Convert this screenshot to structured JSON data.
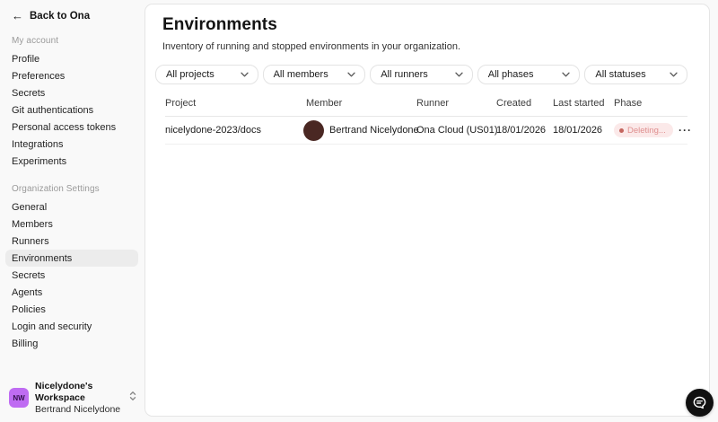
{
  "sidebar": {
    "back_label": "Back to Ona",
    "sections": [
      {
        "label": "My account",
        "items": [
          "Profile",
          "Preferences",
          "Secrets",
          "Git authentications",
          "Personal access tokens",
          "Integrations",
          "Experiments"
        ]
      },
      {
        "label": "Organization Settings",
        "items": [
          "General",
          "Members",
          "Runners",
          "Environments",
          "Secrets",
          "Agents",
          "Policies",
          "Login and security",
          "Billing"
        ]
      }
    ],
    "active_item": "Environments",
    "workspace": {
      "initials": "NW",
      "name": "Nicelydone's Workspace",
      "member": "Bertrand Nicelydone"
    }
  },
  "main": {
    "title": "Environments",
    "description": "Inventory of running and stopped environments in your organization.",
    "filters": [
      "All projects",
      "All members",
      "All runners",
      "All phases",
      "All statuses"
    ],
    "table": {
      "columns": [
        "Project",
        "Member",
        "Runner",
        "Created",
        "Last started",
        "Phase"
      ],
      "rows": [
        {
          "project": "nicelydone-2023/docs",
          "member": "Bertrand Nicelydone",
          "runner": "Ona Cloud (US01)",
          "created": "18/01/2026",
          "last_started": "18/01/2026",
          "phase": "Deleting..."
        }
      ]
    }
  },
  "icons": {
    "back_arrow": "←",
    "row_actions": "···"
  },
  "colors": {
    "workspace_avatar": "#bf6cf2",
    "member_avatar": "#4a2823",
    "phase_badge_bg": "#fbe9e9",
    "phase_badge_text": "#df8f8f",
    "phase_badge_dot": "#c4655e",
    "active_item_bg": "#ececec",
    "chat_button": "#101010"
  }
}
